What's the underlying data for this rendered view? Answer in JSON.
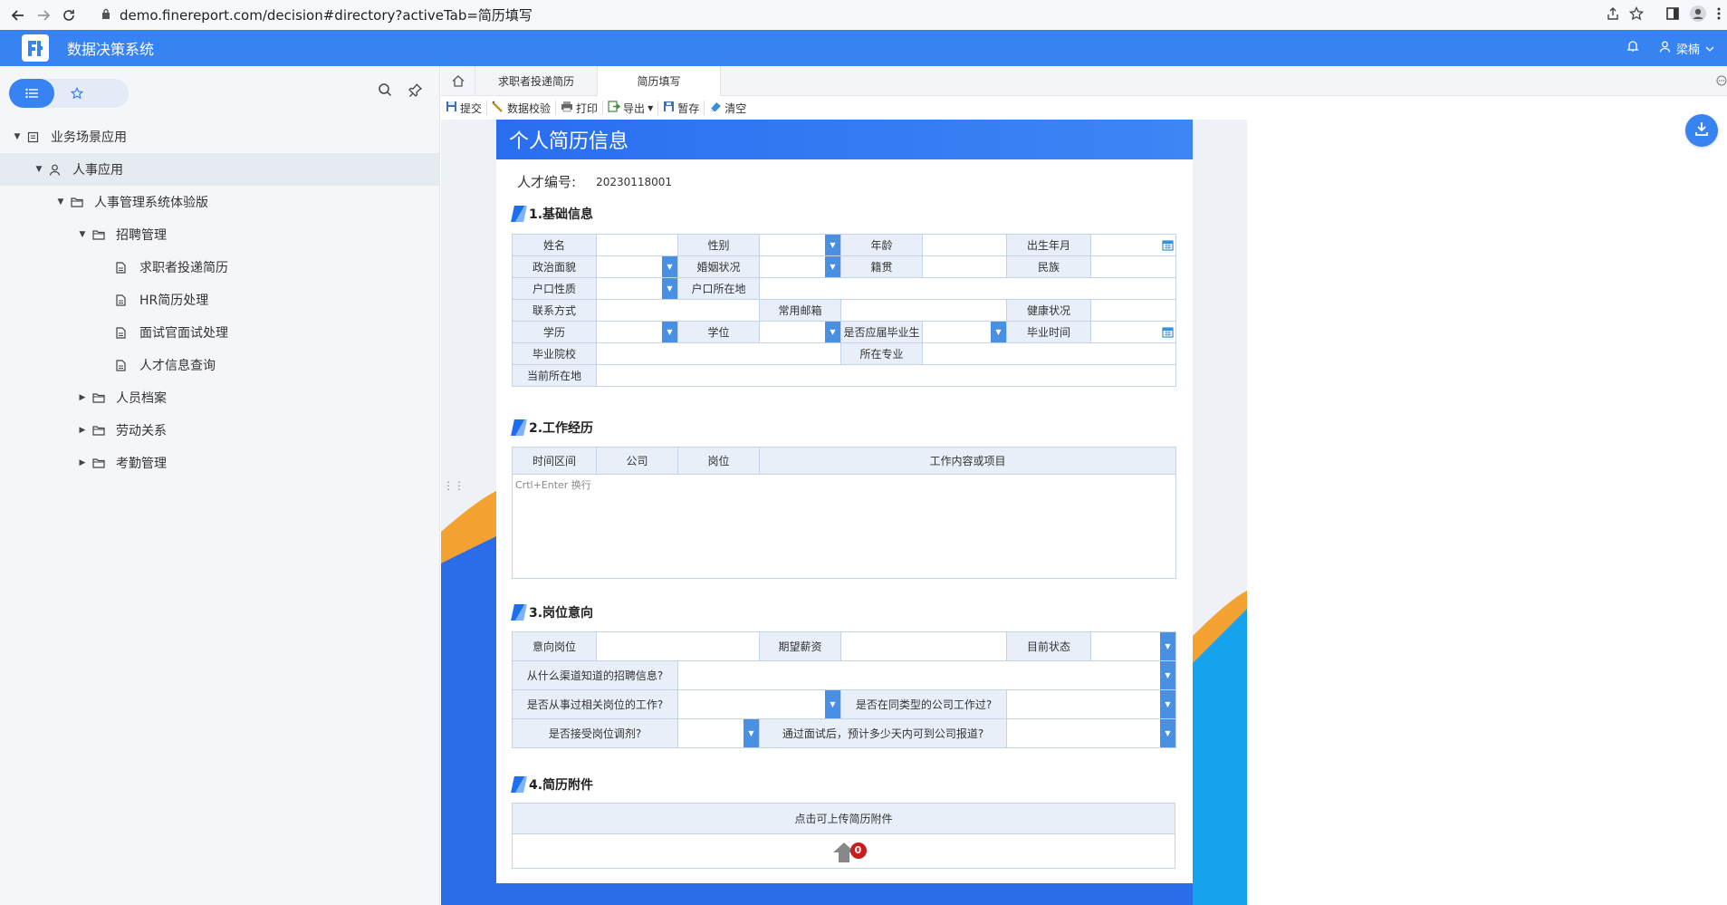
{
  "browser": {
    "url": "demo.finereport.com/decision#directory?activeTab=简历填写"
  },
  "app": {
    "title": "数据决策系统",
    "user": "梁楠",
    "accent": "#3883f2"
  },
  "sidebar": {
    "tree": [
      {
        "label": "业务场景应用",
        "level": 0,
        "expanded": true,
        "icon": "report-icon"
      },
      {
        "label": "人事应用",
        "level": 1,
        "expanded": true,
        "icon": "user-icon",
        "active": true
      },
      {
        "label": "人事管理系统体验版",
        "level": 2,
        "expanded": true,
        "icon": "folder-icon"
      },
      {
        "label": "招聘管理",
        "level": 3,
        "expanded": true,
        "icon": "folder-icon"
      },
      {
        "label": "求职者投递简历",
        "level": 4,
        "icon": "file-icon"
      },
      {
        "label": "HR简历处理",
        "level": 4,
        "icon": "file-icon"
      },
      {
        "label": "面试官面试处理",
        "level": 4,
        "icon": "file-icon"
      },
      {
        "label": "人才信息查询",
        "level": 4,
        "icon": "file-icon"
      },
      {
        "label": "人员档案",
        "level": 3,
        "expanded": false,
        "icon": "folder-icon"
      },
      {
        "label": "劳动关系",
        "level": 3,
        "expanded": false,
        "icon": "folder-icon"
      },
      {
        "label": "考勤管理",
        "level": 3,
        "expanded": false,
        "icon": "folder-icon"
      }
    ]
  },
  "tabs": [
    {
      "label": "求职者投递简历"
    },
    {
      "label": "简历填写",
      "active": true
    }
  ],
  "toolbar": {
    "submit": "提交",
    "verify": "数据校验",
    "print": "打印",
    "export": "导出",
    "save": "暂存",
    "clear": "清空"
  },
  "form": {
    "title": "个人简历信息",
    "id_label": "人才编号:",
    "id_value": "20230118001",
    "s1": {
      "title": "1.基础信息",
      "name": "姓名",
      "gender": "性别",
      "age": "年龄",
      "birth": "出生年月",
      "political": "政治面貌",
      "marital": "婚姻状况",
      "native": "籍贯",
      "ethnic": "民族",
      "hukou_type": "户口性质",
      "hukou_loc": "户口所在地",
      "contact": "联系方式",
      "email": "常用邮箱",
      "health": "健康状况",
      "edu": "学历",
      "degree": "学位",
      "fresh": "是否应届毕业生",
      "grad_time": "毕业时间",
      "school": "毕业院校",
      "major": "所在专业",
      "location": "当前所在地"
    },
    "s2": {
      "title": "2.工作经历",
      "period": "时间区间",
      "company": "公司",
      "position": "岗位",
      "content": "工作内容或项目",
      "placeholder": "Crtl+Enter 换行"
    },
    "s3": {
      "title": "3.岗位意向",
      "intent_pos": "意向岗位",
      "salary": "期望薪资",
      "status": "目前状态",
      "channel": "从什么渠道知道的招聘信息?",
      "related": "是否从事过相关岗位的工作?",
      "same_type": "是否在同类型的公司工作过?",
      "adjust": "是否接受岗位调剂?",
      "report_days": "通过面试后，预计多少天内可到公司报道?"
    },
    "s4": {
      "title": "4.简历附件",
      "upload_label": "点击可上传简历附件",
      "upload_count": "0"
    }
  }
}
